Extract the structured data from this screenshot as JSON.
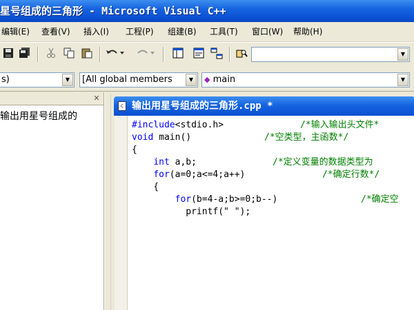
{
  "window": {
    "title": "星号组成的三角形 - Microsoft Visual C++"
  },
  "menu": {
    "items": [
      {
        "label": "编辑(E)"
      },
      {
        "label": "查看(V)"
      },
      {
        "label": "插入(I)"
      },
      {
        "label": "工程(P)"
      },
      {
        "label": "组建(B)"
      },
      {
        "label": "工具(T)"
      },
      {
        "label": "窗口(W)"
      },
      {
        "label": "帮助(H)"
      }
    ]
  },
  "toolbar": {
    "icons": [
      "save-icon",
      "save-all-icon",
      "cut-icon",
      "copy-icon",
      "paste-icon",
      "undo-icon",
      "redo-icon",
      "workspace-icon",
      "output-icon",
      "window-list-icon",
      "find-in-files-icon"
    ],
    "find_combo_value": ""
  },
  "wizard_bar": {
    "class_combo_value": "s)",
    "filter_combo_value": "[All global members",
    "member_combo_value": "main"
  },
  "workspace": {
    "tree_item": "输出用星号组成的"
  },
  "editor": {
    "title": "输出用星号组成的三角形.cpp *",
    "lines": [
      {
        "code": "#include<stdio.h>",
        "comment": "/*输入输出头文件*"
      },
      {
        "code": "void main()",
        "comment": "/*空类型，主函数*/"
      },
      {
        "code": "{",
        "comment": ""
      },
      {
        "code": "    int a,b;",
        "comment": "/*定义变量的数据类型为"
      },
      {
        "code": "    for(a=0;a<=4;a++)",
        "comment": "/*确定行数*/"
      },
      {
        "code": "    {",
        "comment": ""
      },
      {
        "code": "        for(b=4-a;b>=0;b--)",
        "comment": "/*确定空"
      },
      {
        "code": "          printf(\" \");",
        "comment": ""
      }
    ]
  },
  "colors": {
    "keyword": "#0000ff",
    "comment": "#008000",
    "titlebar": "#0a4fd1"
  }
}
